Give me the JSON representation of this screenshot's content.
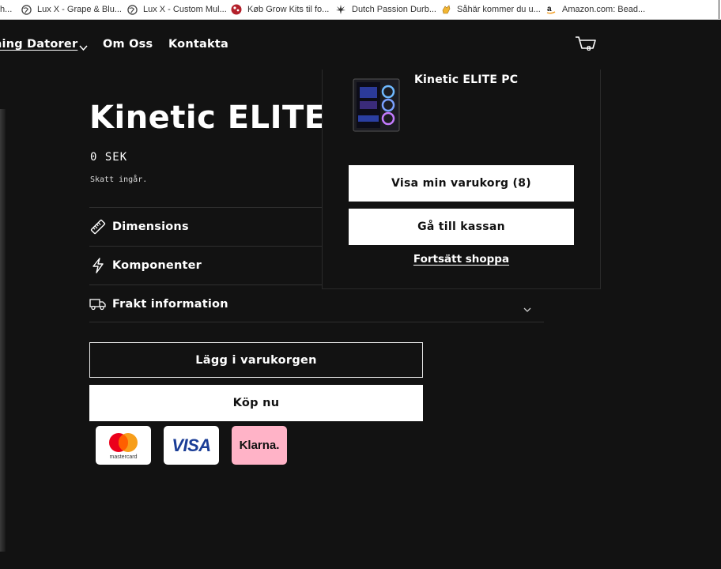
{
  "bookmarks": {
    "cut_item": "h...",
    "items": [
      {
        "label": "Lux X - Grape & Blu...",
        "icon": "globe-icon"
      },
      {
        "label": "Lux X - Custom Mul...",
        "icon": "globe-icon"
      },
      {
        "label": "Køb Grow Kits til fo...",
        "icon": "growkit-icon"
      },
      {
        "label": "Dutch Passion Durb...",
        "icon": "leaf-icon"
      },
      {
        "label": "Såhär kommer du u...",
        "icon": "hand-icon"
      },
      {
        "label": "Amazon.com: Bead...",
        "icon": "amazon-icon"
      }
    ]
  },
  "nav": {
    "gaming": "ning Datorer",
    "om_oss": "Om Oss",
    "kontakta": "Kontakta",
    "cart_count": "8"
  },
  "product": {
    "title": "Kinetic ELITE",
    "price": "0 SEK",
    "tax_note": "Skatt ingår."
  },
  "accordion": [
    {
      "label": "Dimensions",
      "icon": "ruler-icon"
    },
    {
      "label": "Komponenter",
      "icon": "lightning-icon"
    },
    {
      "label": "Frakt information",
      "icon": "truck-icon"
    }
  ],
  "actions": {
    "add_to_cart": "Lägg i varukorgen",
    "buy_now": "Köp nu"
  },
  "payments": {
    "mastercard": "mastercard",
    "visa": "VISA",
    "klarna": "Klarna."
  },
  "cart_popup": {
    "product_name": "Kinetic ELITE PC",
    "view_cart": "Visa min varukorg (8)",
    "checkout": "Gå till kassan",
    "continue": "Fortsätt shoppa"
  },
  "colors": {
    "background": "#121212",
    "text": "#ffffff",
    "klarna_pink": "#ffb3c7",
    "visa_blue": "#1a3d96"
  }
}
